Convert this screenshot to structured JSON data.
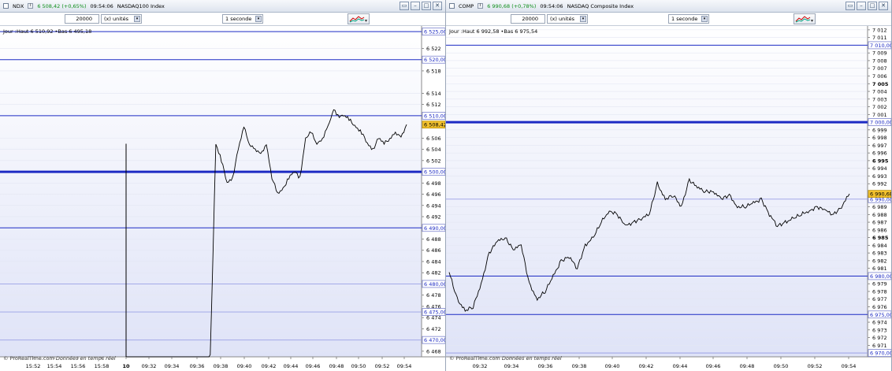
{
  "left_window": {
    "ticker": "NDX",
    "price_change": "6 508,42 (+0,65%)",
    "time": "09:54:06",
    "name": "NASDAQ100 Index",
    "units_value": "20000",
    "units_label": "(x) unités",
    "period": "1 seconde",
    "day_status": "Jour :Haut 6 510,92 •Bas 6 495,18",
    "footer_brand": "© ProRealTime.com",
    "footer_note": "Données en temps réel",
    "current_price_label": "6 508,42"
  },
  "right_window": {
    "ticker": "COMP",
    "price_change": "6 990,68 (+0,78%)",
    "time": "09:54:06",
    "name": "NASDAQ Composite Index",
    "units_value": "20000",
    "units_label": "(x) unités",
    "period": "1 seconde",
    "day_status": "Jour :Haut 6 992,58 •Bas 6 975,54",
    "footer_brand": "© ProRealTime.com",
    "footer_note": "Données en temps réel",
    "current_price_label": "6 990,68"
  },
  "window_buttons": [
    "▭",
    "–",
    "□",
    "✕"
  ],
  "chart_data": [
    {
      "type": "line",
      "title": "NASDAQ100 Index",
      "ylim": [
        6467,
        6526
      ],
      "y_ticks": [
        "6 522",
        "6 518",
        "6 514",
        "6 512",
        "6 506",
        "6 504",
        "6 502",
        "6 498",
        "6 496",
        "6 494",
        "6 492",
        "6 488",
        "6 486",
        "6 484",
        "6 482",
        "6 478",
        "6 476",
        "6 474",
        "6 472",
        "6 468"
      ],
      "y_tick_values": [
        6522,
        6518,
        6514,
        6512,
        6506,
        6504,
        6502,
        6498,
        6496,
        6494,
        6492,
        6488,
        6486,
        6484,
        6482,
        6478,
        6476,
        6474,
        6472,
        6468
      ],
      "level_labels": [
        "6 525,00",
        "6 520,00",
        "6 510,00",
        "6 500,00",
        "6 490,00",
        "6 480,00",
        "6 475,00",
        "6 470,00"
      ],
      "level_values": [
        6525,
        6520,
        6510,
        6500,
        6490,
        6480,
        6475,
        6470
      ],
      "major_level": 6500,
      "x_tick_labels": [
        "15:52",
        "15:54",
        "15:56",
        "15:58",
        "10",
        "09:32",
        "09:34",
        "09:36",
        "09:38",
        "09:40",
        "09:42",
        "09:44",
        "09:46",
        "09:48",
        "09:50",
        "09:52",
        "09:54"
      ],
      "x": [
        0.0,
        0.3,
        0.32,
        0.34,
        0.36,
        0.38,
        0.4,
        0.42,
        0.44,
        0.46,
        0.48,
        0.5,
        0.52,
        0.54,
        0.56,
        0.58,
        0.6,
        0.62,
        0.64,
        0.66,
        0.68,
        0.7,
        0.72,
        0.74,
        0.76,
        0.78,
        0.8,
        0.82,
        0.84,
        0.86,
        0.88,
        0.9,
        0.92,
        0.94,
        0.96,
        0.98,
        1.0
      ],
      "values": [
        6467,
        6467,
        6505,
        6502,
        6498,
        6499,
        6504,
        6508,
        6505,
        6504,
        6503,
        6505,
        6499,
        6496,
        6497,
        6499,
        6500,
        6499,
        6506,
        6507,
        6505,
        6506,
        6508,
        6511,
        6510,
        6510,
        6509,
        6508,
        6507,
        6505,
        6504,
        6506,
        6505,
        6506,
        6507,
        6506,
        6508.42
      ]
    },
    {
      "type": "line",
      "title": "NASDAQ Composite Index",
      "ylim": [
        6969.5,
        7012.5
      ],
      "y_ticks": [
        "7 012",
        "7 011",
        "7 009",
        "7 008",
        "7 007",
        "7 006",
        "7 005",
        "7 004",
        "7 003",
        "7 002",
        "7 001",
        "6 999",
        "6 998",
        "6 997",
        "6 996",
        "6 995",
        "6 994",
        "6 993",
        "6 992",
        "6 989",
        "6 988",
        "6 987",
        "6 986",
        "6 985",
        "6 984",
        "6 983",
        "6 982",
        "6 981",
        "6 979",
        "6 978",
        "6 977",
        "6 976",
        "6 974",
        "6 973",
        "6 972",
        "6 971"
      ],
      "y_tick_values": [
        7012,
        7011,
        7009,
        7008,
        7007,
        7006,
        7005,
        7004,
        7003,
        7002,
        7001,
        6999,
        6998,
        6997,
        6996,
        6995,
        6994,
        6993,
        6992,
        6989,
        6988,
        6987,
        6986,
        6985,
        6984,
        6983,
        6982,
        6981,
        6979,
        6978,
        6977,
        6976,
        6974,
        6973,
        6972,
        6971
      ],
      "bold_ticks": [
        "7 005",
        "6 995",
        "6 985"
      ],
      "level_labels": [
        "7 010,00",
        "7 000,00",
        "6 990,00",
        "6 980,00",
        "6 975,00",
        "6 970,00"
      ],
      "level_values": [
        7010,
        7000,
        6990,
        6980,
        6975,
        6970
      ],
      "major_level": 7000,
      "x_tick_labels": [
        "09:32",
        "09:34",
        "09:36",
        "09:38",
        "09:40",
        "09:42",
        "09:44",
        "09:46",
        "09:48",
        "09:50",
        "09:52",
        "09:54"
      ],
      "x": [
        0.0,
        0.02,
        0.04,
        0.06,
        0.08,
        0.1,
        0.12,
        0.14,
        0.16,
        0.18,
        0.2,
        0.22,
        0.24,
        0.26,
        0.28,
        0.3,
        0.32,
        0.34,
        0.36,
        0.38,
        0.4,
        0.42,
        0.44,
        0.46,
        0.48,
        0.5,
        0.52,
        0.54,
        0.56,
        0.58,
        0.6,
        0.62,
        0.64,
        0.66,
        0.68,
        0.7,
        0.72,
        0.74,
        0.76,
        0.78,
        0.8,
        0.82,
        0.84,
        0.86,
        0.88,
        0.9,
        0.92,
        0.94,
        0.96,
        0.98,
        1.0
      ],
      "values": [
        6980.5,
        6977,
        6975.5,
        6976,
        6979,
        6983,
        6984.5,
        6985,
        6983.5,
        6984,
        6979,
        6977,
        6978,
        6980,
        6982,
        6982.5,
        6981,
        6984,
        6985,
        6987,
        6988.5,
        6988,
        6986.5,
        6987,
        6987.5,
        6988,
        6992,
        6990,
        6990.5,
        6989,
        6992.5,
        6991.5,
        6991,
        6991,
        6990,
        6990.5,
        6989,
        6989,
        6989.5,
        6990,
        6988,
        6986.5,
        6987,
        6987.5,
        6988,
        6988.5,
        6989,
        6988.5,
        6988,
        6989,
        6990.68
      ]
    }
  ],
  "colors": {
    "price_badge": "#f2c12e",
    "level_line": "#1d2bc4",
    "accent_green": "#0f8f1a"
  }
}
